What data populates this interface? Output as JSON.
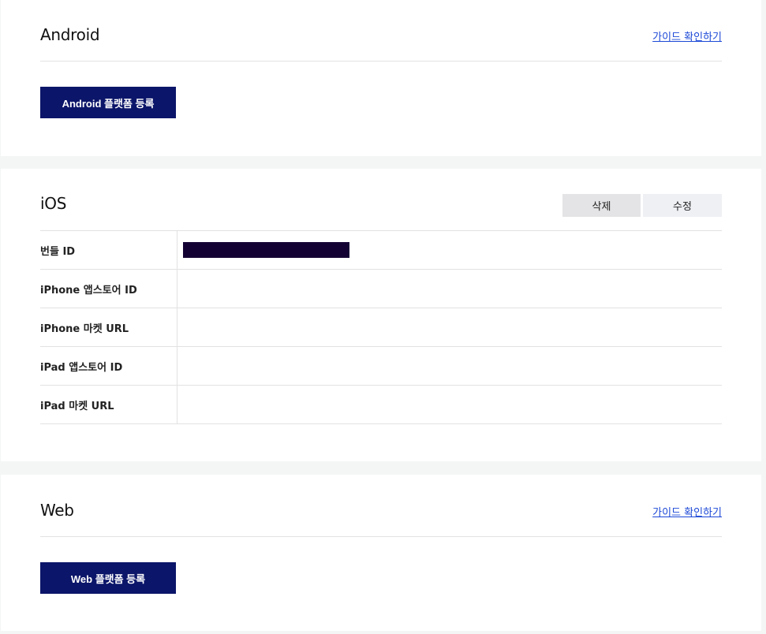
{
  "android": {
    "title": "Android",
    "guide_link": "가이드 확인하기",
    "register_button": "Android 플랫폼 등록"
  },
  "ios": {
    "title": "iOS",
    "delete_button": "삭제",
    "edit_button": "수정",
    "rows": [
      {
        "label": "번들 ID",
        "value": ""
      },
      {
        "label": "iPhone 앱스토어 ID",
        "value": ""
      },
      {
        "label": "iPhone 마켓 URL",
        "value": ""
      },
      {
        "label": "iPad 앱스토어 ID",
        "value": ""
      },
      {
        "label": "iPad 마켓 URL",
        "value": ""
      }
    ]
  },
  "web": {
    "title": "Web",
    "guide_link": "가이드 확인하기",
    "register_button": "Web 플랫폼 등록"
  },
  "colors": {
    "primary_button": "#0b1569",
    "link": "#1a47d6",
    "redaction": "#140134"
  }
}
